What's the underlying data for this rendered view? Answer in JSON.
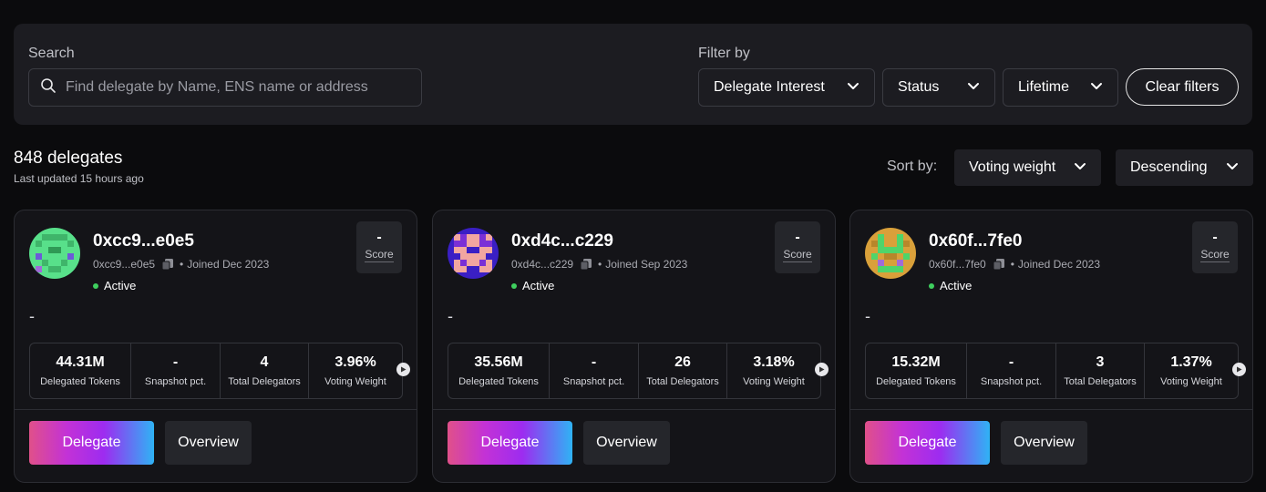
{
  "search": {
    "label": "Search",
    "placeholder": "Find delegate by Name, ENS name or address"
  },
  "filters": {
    "label": "Filter by",
    "delegate_interest": "Delegate Interest",
    "status": "Status",
    "lifetime": "Lifetime",
    "clear": "Clear filters"
  },
  "summary": {
    "count": "848 delegates",
    "updated": "Last updated 15 hours ago"
  },
  "sort": {
    "label": "Sort by:",
    "field": "Voting weight",
    "direction": "Descending"
  },
  "stat_labels": {
    "delegated": "Delegated Tokens",
    "snapshot": "Snapshot pct.",
    "delegators": "Total Delegators",
    "weight": "Voting Weight"
  },
  "cards": [
    {
      "name": "0xcc9...e0e5",
      "short_address": "0xcc9...e0e5",
      "joined": "Joined Dec 2023",
      "status": "Active",
      "score_value": "-",
      "score_label": "Score",
      "description": "-",
      "delegated_tokens": "44.31M",
      "snapshot_pct": "-",
      "total_delegators": "4",
      "voting_weight": "3.96%",
      "delegate_label": "Delegate",
      "overview_label": "Overview"
    },
    {
      "name": "0xd4c...c229",
      "short_address": "0xd4c...c229",
      "joined": "Joined Sep 2023",
      "status": "Active",
      "score_value": "-",
      "score_label": "Score",
      "description": "-",
      "delegated_tokens": "35.56M",
      "snapshot_pct": "-",
      "total_delegators": "26",
      "voting_weight": "3.18%",
      "delegate_label": "Delegate",
      "overview_label": "Overview"
    },
    {
      "name": "0x60f...7fe0",
      "short_address": "0x60f...7fe0",
      "joined": "Joined Dec 2023",
      "status": "Active",
      "score_value": "-",
      "score_label": "Score",
      "description": "-",
      "delegated_tokens": "15.32M",
      "snapshot_pct": "-",
      "total_delegators": "3",
      "voting_weight": "1.37%",
      "delegate_label": "Delegate",
      "overview_label": "Overview"
    }
  ],
  "colors": {
    "background": "#0b0b0d",
    "panel": "#1c1c21",
    "active_dot": "#3ecf5e",
    "gradient_start": "#e0508a",
    "gradient_mid": "#9d2cf0",
    "gradient_end": "#2fb3f5"
  }
}
